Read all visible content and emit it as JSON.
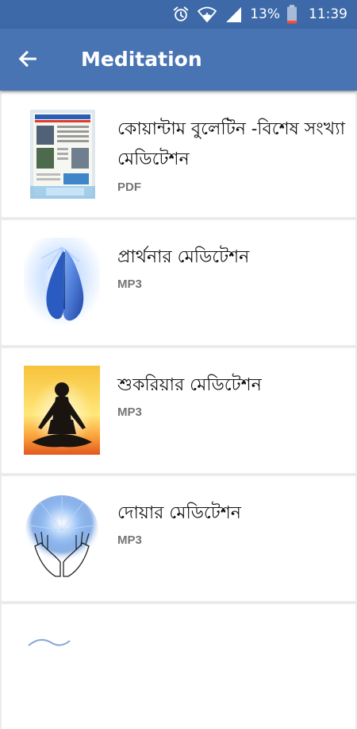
{
  "status_bar": {
    "battery_percent": "13%",
    "time": "11:39",
    "icons": [
      "alarm-icon",
      "wifi-icon",
      "signal-icon",
      "battery-icon"
    ]
  },
  "app_bar": {
    "back_icon": "arrow-left-icon",
    "title": "Meditation"
  },
  "colors": {
    "status_bar": "#3d69a8",
    "app_bar": "#4874b3",
    "list_background": "#ebebeb",
    "card": "#ffffff",
    "type_label": "#757575"
  },
  "items": [
    {
      "title": "কোয়ান্টাম বুলেটিন -বিশেষ সংখ্যা মেডিটেশন",
      "type": "PDF",
      "thumb_icon": "newspaper-thumbnail"
    },
    {
      "title": "প্রার্থনার মেডিটেশন",
      "type": "MP3",
      "thumb_icon": "praying-hands-thumbnail"
    },
    {
      "title": "শুকরিয়ার মেডিটেশন",
      "type": "MP3",
      "thumb_icon": "meditation-silhouette-thumbnail"
    },
    {
      "title": "দোয়ার মেডিটেশন",
      "type": "MP3",
      "thumb_icon": "open-hands-thumbnail"
    },
    {
      "title": "",
      "type": "",
      "thumb_icon": "partial-item-thumbnail"
    }
  ]
}
